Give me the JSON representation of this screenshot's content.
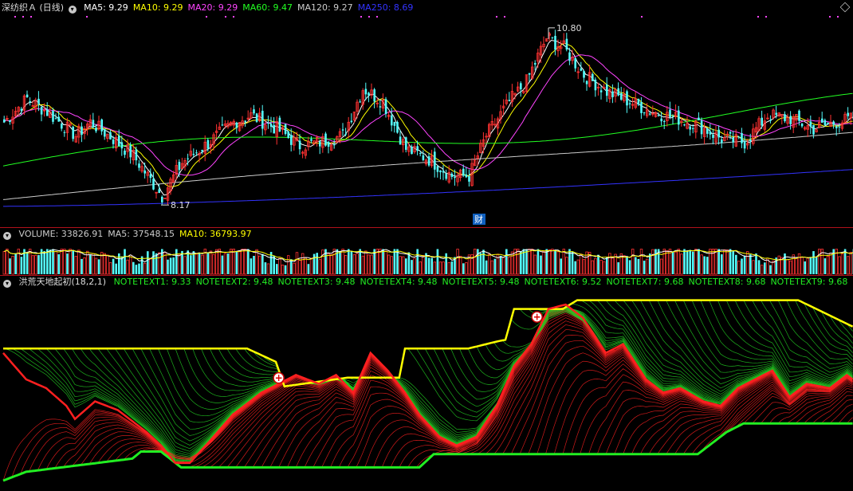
{
  "price_header": {
    "stock_name": "深纺织Ａ",
    "period": "(日线)",
    "items": [
      {
        "label": "MA5: 9.29",
        "color": "#ffffff"
      },
      {
        "label": "MA10: 9.29",
        "color": "#ffff00"
      },
      {
        "label": "MA20: 9.29",
        "color": "#ff44ff"
      },
      {
        "label": "MA60: 9.47",
        "color": "#22ff22"
      },
      {
        "label": "MA120: 9.27",
        "color": "#cccccc"
      },
      {
        "label": "MA250: 8.69",
        "color": "#3333ff"
      }
    ]
  },
  "volume_header": {
    "items": [
      {
        "label": "VOLUME: 33826.91",
        "color": "#cccccc"
      },
      {
        "label": "MA5: 37548.15",
        "color": "#cccccc"
      },
      {
        "label": "MA10: 36793.97",
        "color": "#ffff00"
      }
    ]
  },
  "indicator_header": {
    "name": "洪荒天地起初(18,2,1)",
    "items": [
      {
        "label": "NOTETEXT1: 9.33"
      },
      {
        "label": "NOTETEXT2: 9.48"
      },
      {
        "label": "NOTETEXT3: 9.48"
      },
      {
        "label": "NOTETEXT4: 9.48"
      },
      {
        "label": "NOTETEXT5: 9.48"
      },
      {
        "label": "NOTETEXT6: 9.52"
      },
      {
        "label": "NOTETEXT7: 9.68"
      },
      {
        "label": "NOTETEXT8: 9.68"
      },
      {
        "label": "NOTETEXT9: 9.68"
      }
    ]
  },
  "annotations": {
    "high": "10.80",
    "low": "8.17",
    "cai": "财"
  },
  "colors": {
    "up": "#ff3232",
    "down": "#54fcfc",
    "panel_border": "#b0101a",
    "band_up": "#ff2020",
    "band_down": "#22cc22",
    "upper_line": "#ffff00",
    "lower_line": "#22ee22"
  },
  "chart_data": [
    {
      "type": "candlestick",
      "series_name": "深纺织Ａ",
      "price_range": [
        8.17,
        10.8
      ],
      "high_label": 10.8,
      "low_label": 8.17,
      "close_trend": [
        [
          0,
          9.4
        ],
        [
          8,
          9.75
        ],
        [
          15,
          9.55
        ],
        [
          25,
          9.2
        ],
        [
          30,
          9.4
        ],
        [
          38,
          9.15
        ],
        [
          45,
          8.9
        ],
        [
          55,
          8.3
        ],
        [
          62,
          8.8
        ],
        [
          70,
          9.05
        ],
        [
          80,
          9.4
        ],
        [
          86,
          9.5
        ],
        [
          95,
          9.3
        ],
        [
          103,
          9.05
        ],
        [
          110,
          9.1
        ],
        [
          118,
          9.2
        ],
        [
          125,
          9.9
        ],
        [
          132,
          9.7
        ],
        [
          140,
          9.0
        ],
        [
          148,
          8.85
        ],
        [
          156,
          8.6
        ],
        [
          162,
          8.6
        ],
        [
          168,
          9.2
        ],
        [
          176,
          9.7
        ],
        [
          182,
          10.0
        ],
        [
          189,
          10.65
        ],
        [
          195,
          10.5
        ],
        [
          202,
          10.1
        ],
        [
          210,
          9.85
        ],
        [
          218,
          9.7
        ],
        [
          226,
          9.55
        ],
        [
          235,
          9.45
        ],
        [
          242,
          9.35
        ],
        [
          250,
          9.15
        ],
        [
          258,
          9.1
        ],
        [
          266,
          9.5
        ],
        [
          274,
          9.45
        ],
        [
          282,
          9.3
        ],
        [
          290,
          9.4
        ],
        [
          296,
          9.45
        ]
      ],
      "moving_averages": [
        {
          "name": "MA5",
          "color": "#ffffff",
          "period": 5
        },
        {
          "name": "MA10",
          "color": "#ffff00",
          "period": 10
        },
        {
          "name": "MA20",
          "color": "#ff44ff",
          "period": 20
        },
        {
          "name": "MA60",
          "color": "#22ff22",
          "period": 60
        },
        {
          "name": "MA120",
          "color": "#cccccc",
          "period": 120
        },
        {
          "name": "MA250",
          "color": "#3333ff",
          "period": 250
        }
      ]
    },
    {
      "type": "bar",
      "series_name": "VOLUME",
      "last_value": 33826.91,
      "ma5": 37548.15,
      "ma10": 36793.97,
      "y_range": [
        0,
        90000
      ]
    },
    {
      "type": "area",
      "series_name": "洪荒天地起初(18,2,1)",
      "series": [
        {
          "name": "upper",
          "color": "#ffff00",
          "points": [
            [
              0,
              9.05
            ],
            [
              85,
              9.05
            ],
            [
              95,
              8.9
            ],
            [
              98,
              8.62
            ],
            [
              120,
              8.72
            ],
            [
              138,
              8.72
            ],
            [
              140,
              9.05
            ],
            [
              162,
              9.05
            ],
            [
              172,
              9.13
            ],
            [
              175,
              9.15
            ],
            [
              178,
              9.5
            ],
            [
              195,
              9.5
            ],
            [
              200,
              9.6
            ],
            [
              208,
              9.6
            ],
            [
              250,
              9.6
            ],
            [
              277,
              9.6
            ],
            [
              296,
              9.3
            ]
          ]
        },
        {
          "name": "lower",
          "color": "#22ee22",
          "points": [
            [
              0,
              7.55
            ],
            [
              8,
              7.65
            ],
            [
              45,
              7.8
            ],
            [
              48,
              7.88
            ],
            [
              55,
              7.88
            ],
            [
              62,
              7.7
            ],
            [
              145,
              7.7
            ],
            [
              150,
              7.85
            ],
            [
              242,
              7.85
            ],
            [
              252,
              8.1
            ],
            [
              258,
              8.2
            ],
            [
              296,
              8.2
            ]
          ]
        },
        {
          "name": "close",
          "color": "#ff2020",
          "points": [
            [
              0,
              9.0
            ],
            [
              8,
              8.7
            ],
            [
              15,
              8.6
            ],
            [
              22,
              8.4
            ],
            [
              25,
              8.25
            ],
            [
              32,
              8.45
            ],
            [
              40,
              8.35
            ],
            [
              50,
              8.1
            ],
            [
              55,
              7.95
            ],
            [
              60,
              7.75
            ],
            [
              65,
              7.75
            ],
            [
              72,
              8.0
            ],
            [
              80,
              8.3
            ],
            [
              90,
              8.55
            ],
            [
              96,
              8.65
            ],
            [
              102,
              8.75
            ],
            [
              110,
              8.65
            ],
            [
              116,
              8.75
            ],
            [
              122,
              8.55
            ],
            [
              128,
              9.0
            ],
            [
              134,
              8.8
            ],
            [
              140,
              8.55
            ],
            [
              145,
              8.3
            ],
            [
              152,
              8.05
            ],
            [
              158,
              7.95
            ],
            [
              165,
              8.05
            ],
            [
              172,
              8.4
            ],
            [
              178,
              8.85
            ],
            [
              184,
              9.1
            ],
            [
              190,
              9.5
            ],
            [
              196,
              9.55
            ],
            [
              202,
              9.4
            ],
            [
              210,
              9.0
            ],
            [
              216,
              9.1
            ],
            [
              224,
              8.7
            ],
            [
              230,
              8.55
            ],
            [
              236,
              8.6
            ],
            [
              244,
              8.45
            ],
            [
              250,
              8.4
            ],
            [
              256,
              8.6
            ],
            [
              262,
              8.7
            ],
            [
              268,
              8.8
            ],
            [
              274,
              8.5
            ],
            [
              280,
              8.65
            ],
            [
              288,
              8.6
            ],
            [
              294,
              8.75
            ],
            [
              296,
              8.7
            ]
          ]
        }
      ],
      "markers": [
        {
          "x": 96,
          "label": "+"
        },
        {
          "x": 186,
          "label": "+"
        }
      ]
    }
  ]
}
